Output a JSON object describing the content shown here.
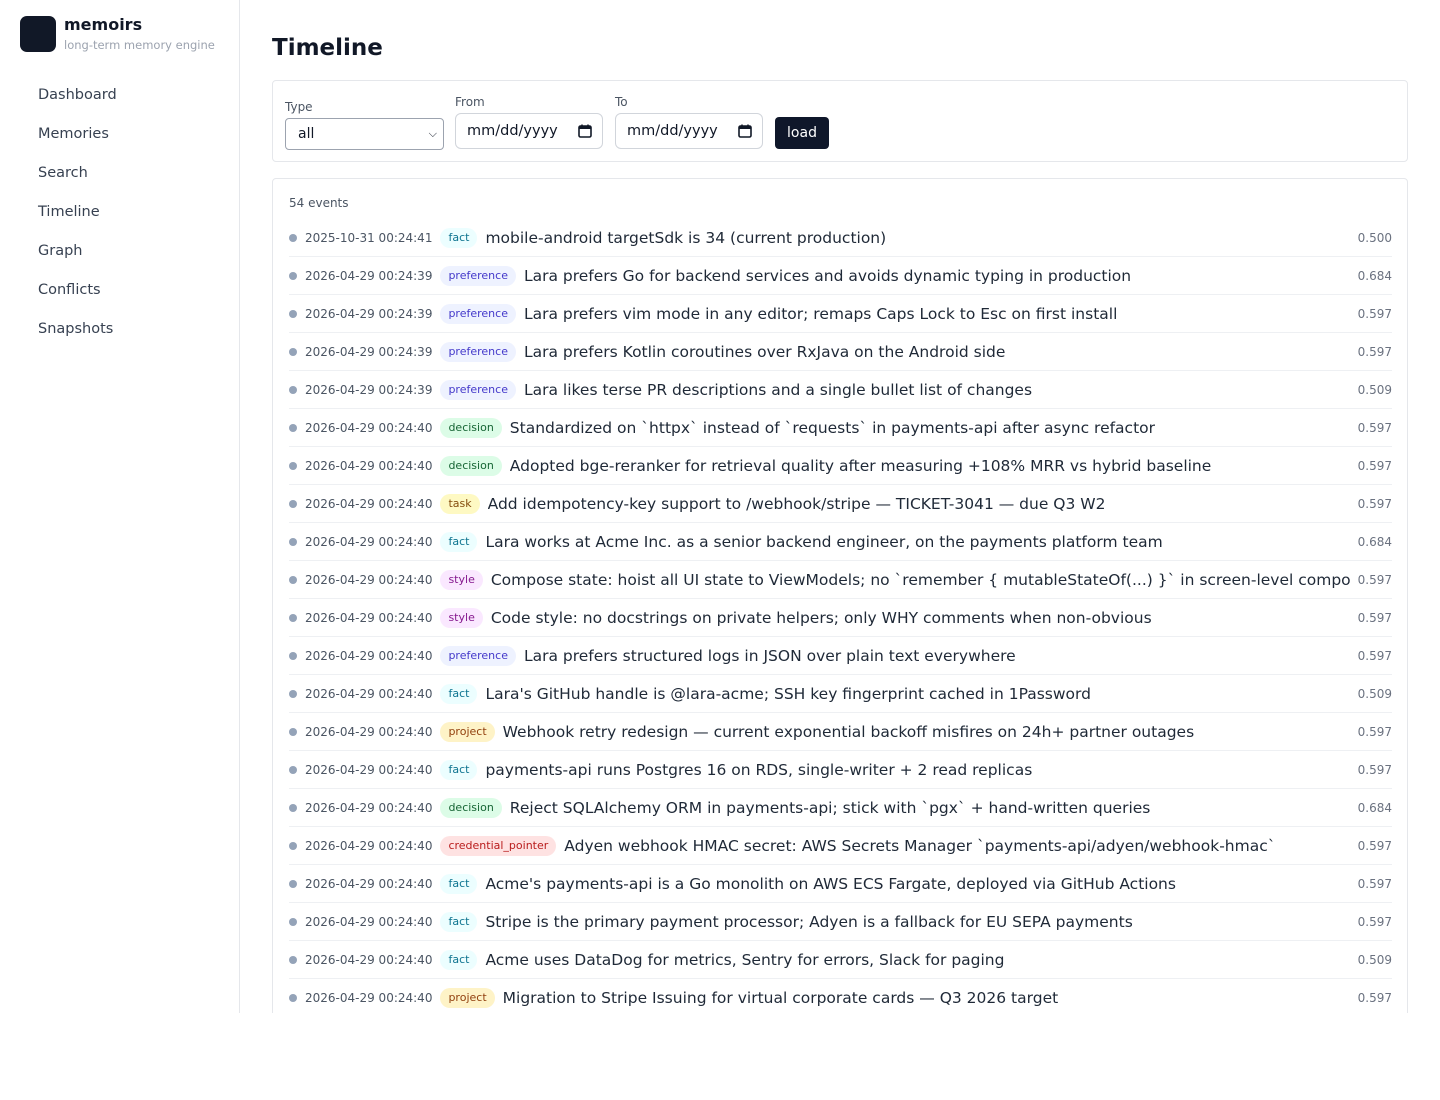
{
  "brand": {
    "name": "memoirs",
    "tagline": "long-term memory engine"
  },
  "nav": [
    {
      "label": "Dashboard",
      "key": "dashboard"
    },
    {
      "label": "Memories",
      "key": "memories"
    },
    {
      "label": "Search",
      "key": "search"
    },
    {
      "label": "Timeline",
      "key": "timeline"
    },
    {
      "label": "Graph",
      "key": "graph"
    },
    {
      "label": "Conflicts",
      "key": "conflicts"
    },
    {
      "label": "Snapshots",
      "key": "snapshots"
    }
  ],
  "page": {
    "title": "Timeline"
  },
  "filters": {
    "type_label": "Type",
    "type_value": "all",
    "from_label": "From",
    "from_value": "mm/dd/yyyy",
    "to_label": "To",
    "to_value": "mm/dd/yyyy",
    "load_label": "load"
  },
  "events_count": "54 events",
  "events": [
    {
      "ts": "2025-10-31 00:24:41",
      "type": "fact",
      "text": "mobile-android targetSdk is 34 (current production)",
      "score": "0.500"
    },
    {
      "ts": "2026-04-29 00:24:39",
      "type": "preference",
      "text": "Lara prefers Go for backend services and avoids dynamic typing in production",
      "score": "0.684"
    },
    {
      "ts": "2026-04-29 00:24:39",
      "type": "preference",
      "text": "Lara prefers vim mode in any editor; remaps Caps Lock to Esc on first install",
      "score": "0.597"
    },
    {
      "ts": "2026-04-29 00:24:39",
      "type": "preference",
      "text": "Lara prefers Kotlin coroutines over RxJava on the Android side",
      "score": "0.597"
    },
    {
      "ts": "2026-04-29 00:24:39",
      "type": "preference",
      "text": "Lara likes terse PR descriptions and a single bullet list of changes",
      "score": "0.509"
    },
    {
      "ts": "2026-04-29 00:24:40",
      "type": "decision",
      "text": "Standardized on `httpx` instead of `requests` in payments-api after async refactor",
      "score": "0.597"
    },
    {
      "ts": "2026-04-29 00:24:40",
      "type": "decision",
      "text": "Adopted bge-reranker for retrieval quality after measuring +108% MRR vs hybrid baseline",
      "score": "0.597"
    },
    {
      "ts": "2026-04-29 00:24:40",
      "type": "task",
      "text": "Add idempotency-key support to /webhook/stripe — TICKET-3041 — due Q3 W2",
      "score": "0.597"
    },
    {
      "ts": "2026-04-29 00:24:40",
      "type": "fact",
      "text": "Lara works at Acme Inc. as a senior backend engineer, on the payments platform team",
      "score": "0.684"
    },
    {
      "ts": "2026-04-29 00:24:40",
      "type": "style",
      "text": "Compose state: hoist all UI state to ViewModels; no `remember { mutableStateOf(...) }` in screen-level composables",
      "score": "0.597"
    },
    {
      "ts": "2026-04-29 00:24:40",
      "type": "style",
      "text": "Code style: no docstrings on private helpers; only WHY comments when non-obvious",
      "score": "0.597"
    },
    {
      "ts": "2026-04-29 00:24:40",
      "type": "preference",
      "text": "Lara prefers structured logs in JSON over plain text everywhere",
      "score": "0.597"
    },
    {
      "ts": "2026-04-29 00:24:40",
      "type": "fact",
      "text": "Lara's GitHub handle is @lara-acme; SSH key fingerprint cached in 1Password",
      "score": "0.509"
    },
    {
      "ts": "2026-04-29 00:24:40",
      "type": "project",
      "text": "Webhook retry redesign — current exponential backoff misfires on 24h+ partner outages",
      "score": "0.597"
    },
    {
      "ts": "2026-04-29 00:24:40",
      "type": "fact",
      "text": "payments-api runs Postgres 16 on RDS, single-writer + 2 read replicas",
      "score": "0.597"
    },
    {
      "ts": "2026-04-29 00:24:40",
      "type": "decision",
      "text": "Reject SQLAlchemy ORM in payments-api; stick with `pgx` + hand-written queries",
      "score": "0.684"
    },
    {
      "ts": "2026-04-29 00:24:40",
      "type": "credential_pointer",
      "text": "Adyen webhook HMAC secret: AWS Secrets Manager `payments-api/adyen/webhook-hmac`",
      "score": "0.597"
    },
    {
      "ts": "2026-04-29 00:24:40",
      "type": "fact",
      "text": "Acme's payments-api is a Go monolith on AWS ECS Fargate, deployed via GitHub Actions",
      "score": "0.597"
    },
    {
      "ts": "2026-04-29 00:24:40",
      "type": "fact",
      "text": "Stripe is the primary payment processor; Adyen is a fallback for EU SEPA payments",
      "score": "0.597"
    },
    {
      "ts": "2026-04-29 00:24:40",
      "type": "fact",
      "text": "Acme uses DataDog for metrics, Sentry for errors, Slack for paging",
      "score": "0.509"
    },
    {
      "ts": "2026-04-29 00:24:40",
      "type": "project",
      "text": "Migration to Stripe Issuing for virtual corporate cards — Q3 2026 target",
      "score": "0.597"
    }
  ]
}
